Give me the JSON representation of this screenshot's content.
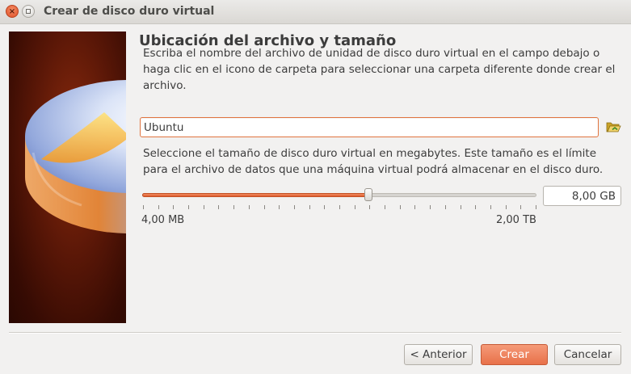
{
  "window": {
    "title": "Crear de disco duro virtual",
    "close_glyph": "×"
  },
  "page": {
    "heading": "Ubicación del archivo y tamaño",
    "location_description": "Escriba el nombre del archivo de unidad de disco duro virtual en el campo debajo o haga clic en el icono de carpeta para seleccionar una carpeta diferente donde crear el archivo.",
    "file_name_value": "Ubuntu",
    "folder_icon": "folder-open-icon",
    "size_description": "Seleccione el tamaño de disco duro virtual en megabytes. Este tamaño es el límite para el archivo de datos que una máquina virtual podrá almacenar en el disco duro.",
    "size_slider": {
      "position_fraction": 0.574,
      "min_label": "4,00 MB",
      "max_label": "2,00 TB"
    },
    "size_value": "8,00 GB"
  },
  "buttons": {
    "back_label": "< Anterior",
    "create_label": "Crear",
    "cancel_label": "Cancelar"
  },
  "colors": {
    "accent": "#e8714a",
    "banner_background": "#4a1206",
    "window_background": "#f2f1f0"
  }
}
